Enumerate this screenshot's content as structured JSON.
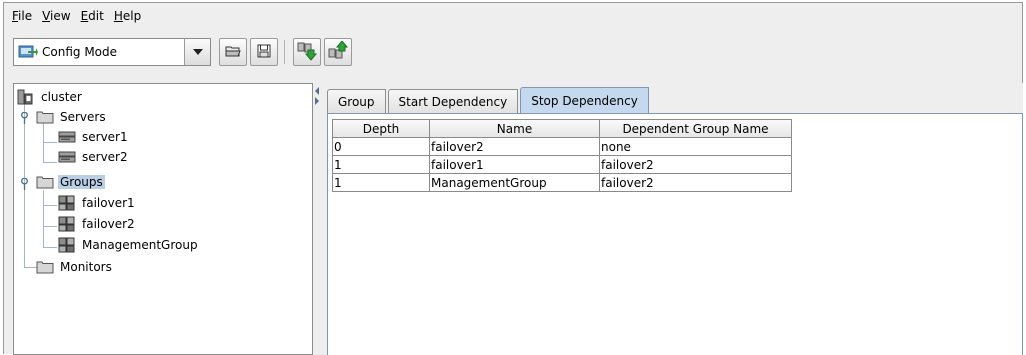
{
  "menu": [
    {
      "mnemonic": "F",
      "rest": "ile"
    },
    {
      "mnemonic": "V",
      "rest": "iew"
    },
    {
      "mnemonic": "E",
      "rest": "dit"
    },
    {
      "mnemonic": "H",
      "rest": "elp"
    }
  ],
  "toolbar": {
    "mode_value": "Config Mode",
    "buttons": [
      "open-folder-icon",
      "save-icon",
      "download-icon",
      "upload-icon"
    ]
  },
  "tree": {
    "root": "cluster",
    "servers": {
      "label": "Servers",
      "items": [
        "server1",
        "server2"
      ]
    },
    "groups": {
      "label": "Groups",
      "items": [
        "failover1",
        "failover2",
        "ManagementGroup"
      ]
    },
    "monitors": {
      "label": "Monitors"
    },
    "selected": "Groups"
  },
  "tabs": [
    "Group",
    "Start Dependency",
    "Stop Dependency"
  ],
  "active_tab": "Stop Dependency",
  "table": {
    "headers": [
      "Depth",
      "Name",
      "Dependent Group Name"
    ],
    "rows": [
      [
        "0",
        "failover2",
        "none"
      ],
      [
        "1",
        "failover1",
        "failover2"
      ],
      [
        "1",
        "ManagementGroup",
        "failover2"
      ]
    ]
  },
  "colors": {
    "selection": "#b8cfe5",
    "active_tab": "#c4d9ee",
    "tree_lines": "#9fb6cc",
    "folder": "#d6d6d6"
  }
}
